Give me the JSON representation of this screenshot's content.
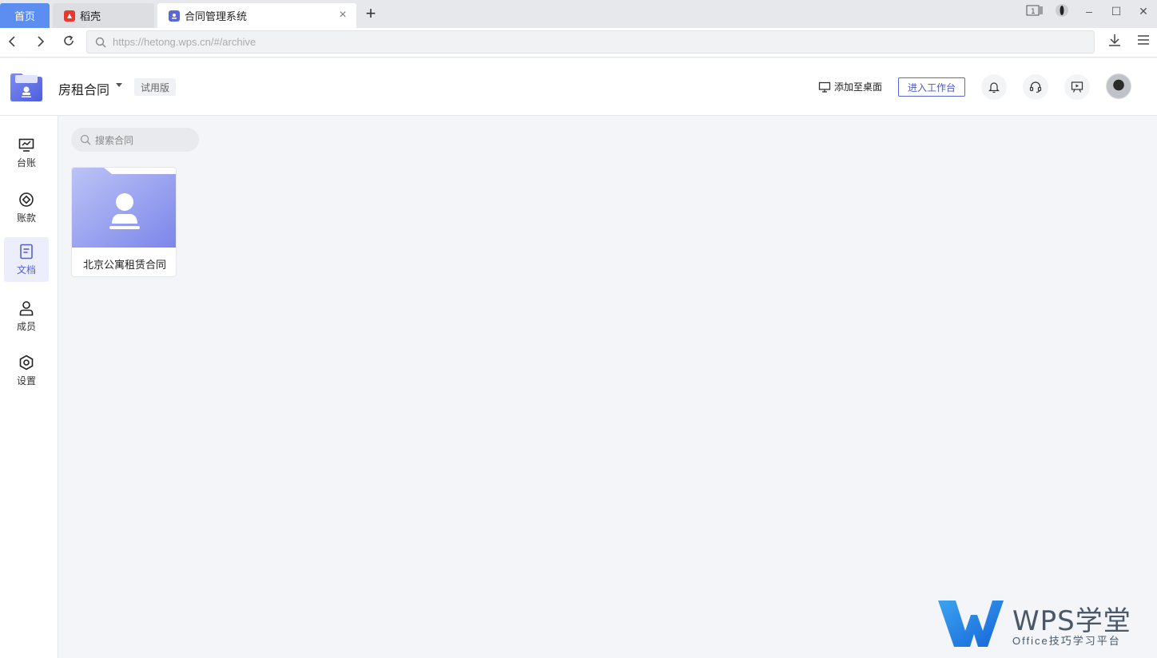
{
  "browser": {
    "home_tab": "首页",
    "tabs": [
      {
        "label": "稻壳",
        "icon": "daoke-icon"
      },
      {
        "label": "合同管理系统",
        "icon": "contract-app-icon"
      }
    ],
    "new_tab_symbol": "+",
    "url": "https://hetong.wps.cn/#/archive",
    "page_counter": "1"
  },
  "header": {
    "workspace_name": "房租合同",
    "edition_badge": "试用版",
    "add_to_desktop": "添加至桌面",
    "enter_workbench": "进入工作台"
  },
  "sidebar": {
    "items": [
      {
        "label": "台账",
        "icon": "ledger-icon",
        "active": false
      },
      {
        "label": "账款",
        "icon": "payment-icon",
        "active": false
      },
      {
        "label": "文档",
        "icon": "document-icon",
        "active": true
      },
      {
        "label": "成员",
        "icon": "member-icon",
        "active": false
      },
      {
        "label": "设置",
        "icon": "settings-icon",
        "active": false
      }
    ]
  },
  "main": {
    "search_placeholder": "搜索合同",
    "folders": [
      {
        "name": "北京公寓租赁合同"
      }
    ]
  },
  "watermark": {
    "title": "WPS学堂",
    "subtitle": "Office技巧学习平台"
  },
  "colors": {
    "accent": "#5a67d8",
    "home_tab": "#5b8ef0",
    "folder_gradient_start": "#b9c0f5",
    "folder_gradient_end": "#7b86ea"
  }
}
